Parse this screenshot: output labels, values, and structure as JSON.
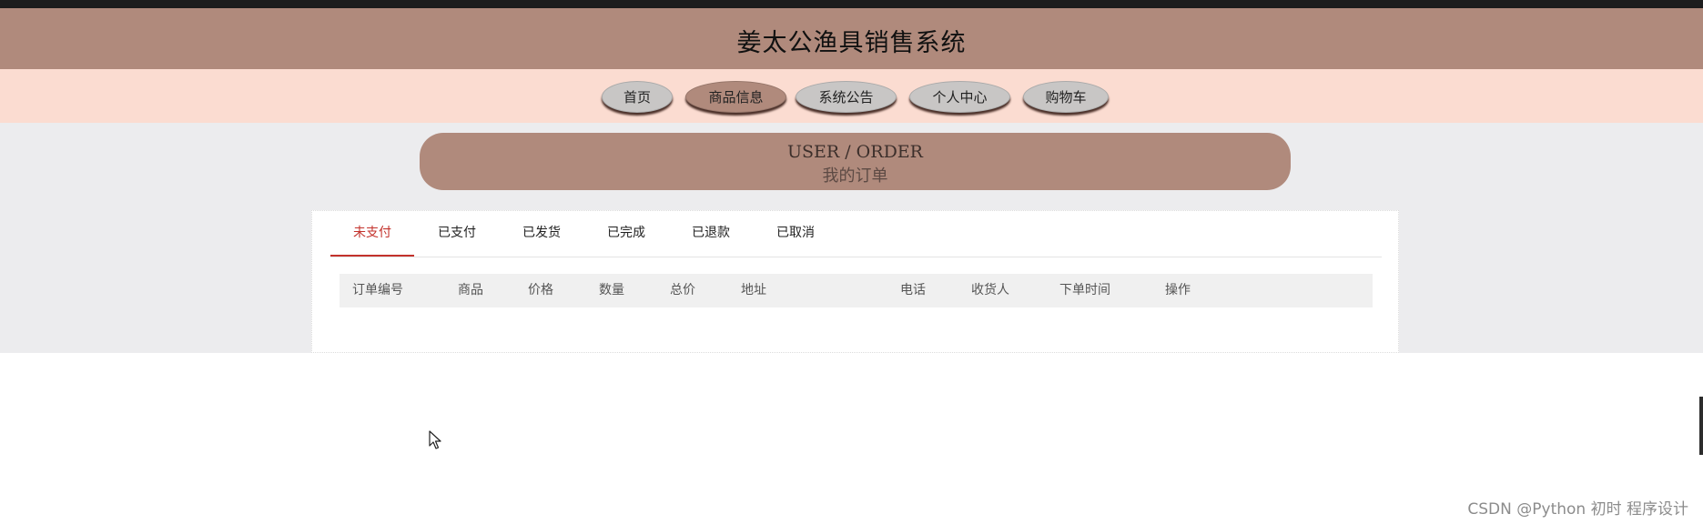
{
  "app": {
    "title": "姜太公渔具销售系统"
  },
  "nav": {
    "items": [
      {
        "label": "首页",
        "active": false
      },
      {
        "label": "商品信息",
        "active": true
      },
      {
        "label": "系统公告",
        "active": false
      },
      {
        "label": "个人中心",
        "active": false
      },
      {
        "label": "购物车",
        "active": false
      }
    ]
  },
  "section": {
    "title_en": "USER / ORDER",
    "title_cn": "我的订单"
  },
  "tabs": {
    "items": [
      {
        "label": "未支付",
        "active": true
      },
      {
        "label": "已支付",
        "active": false
      },
      {
        "label": "已发货",
        "active": false
      },
      {
        "label": "已完成",
        "active": false
      },
      {
        "label": "已退款",
        "active": false
      },
      {
        "label": "已取消",
        "active": false
      }
    ]
  },
  "table": {
    "columns": [
      "订单编号",
      "商品",
      "价格",
      "数量",
      "总价",
      "地址",
      "电话",
      "收货人",
      "下单时间",
      "操作"
    ],
    "rows": []
  },
  "watermark": "CSDN @Python 初时 程序设计",
  "colors": {
    "header_bg": "#b08a7c",
    "nav_bg": "#fbdcd1",
    "main_bg": "#ececee",
    "tab_active": "#c3322c",
    "nav_button": "#c8c6c5"
  },
  "icons": {
    "cursor": "mouse-pointer-icon"
  }
}
